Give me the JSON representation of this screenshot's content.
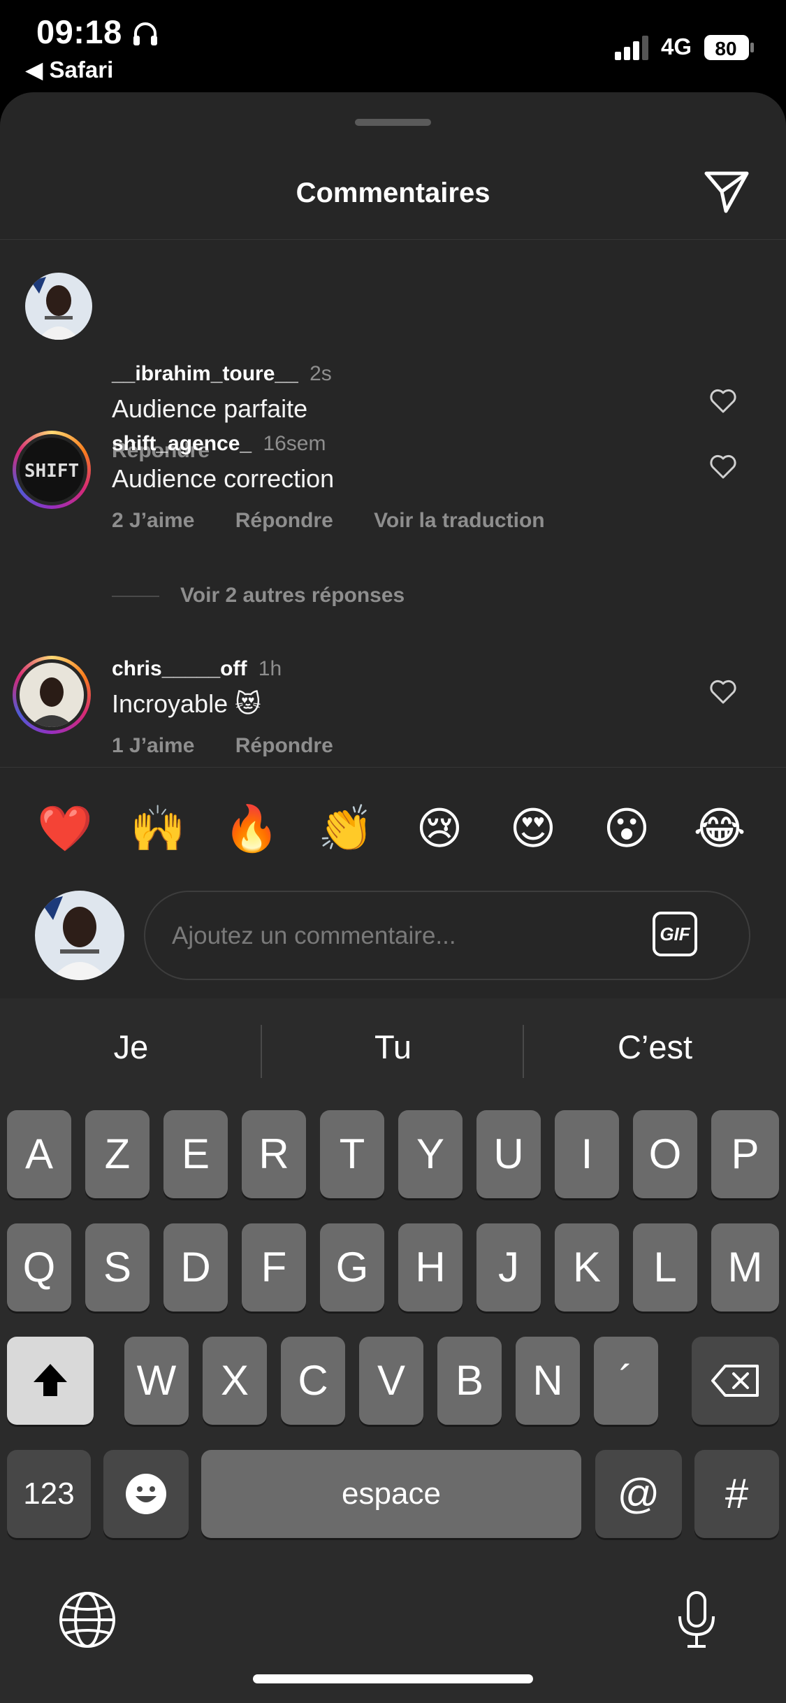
{
  "status": {
    "time": "09:18",
    "back_app": "Safari",
    "network": "4G",
    "battery": "80"
  },
  "sheet": {
    "title": "Commentaires"
  },
  "comments": [
    {
      "user": "__ibrahim_toure__",
      "time": "2s",
      "text": "Audience parfaite",
      "actions": [
        "Répondre"
      ]
    },
    {
      "user": "shift_agence_",
      "time": "16sem",
      "text": "Audience correction",
      "actions": [
        "2 J’aime",
        "Répondre",
        "Voir la traduction"
      ]
    },
    {
      "user": "chris_____off",
      "time": "1h",
      "text": "Incroyable 😻",
      "actions": [
        "1 J’aime",
        "Répondre"
      ]
    }
  ],
  "more_replies": "Voir 2 autres réponses",
  "emoji_bar": [
    "❤️",
    "🙌",
    "🔥",
    "👏",
    "😢",
    "😍",
    "😮",
    "😂"
  ],
  "composer": {
    "placeholder": "Ajoutez un commentaire...",
    "gif_label": "GIF"
  },
  "keyboard": {
    "predictions": [
      "Je",
      "Tu",
      "C’est"
    ],
    "row1": [
      "A",
      "Z",
      "E",
      "R",
      "T",
      "Y",
      "U",
      "I",
      "O",
      "P"
    ],
    "row2": [
      "Q",
      "S",
      "D",
      "F",
      "G",
      "H",
      "J",
      "K",
      "L",
      "M"
    ],
    "row3": [
      "W",
      "X",
      "C",
      "V",
      "B",
      "N",
      "´"
    ],
    "numbers_key": "123",
    "space_key": "espace",
    "at_key": "@",
    "hash_key": "#"
  }
}
